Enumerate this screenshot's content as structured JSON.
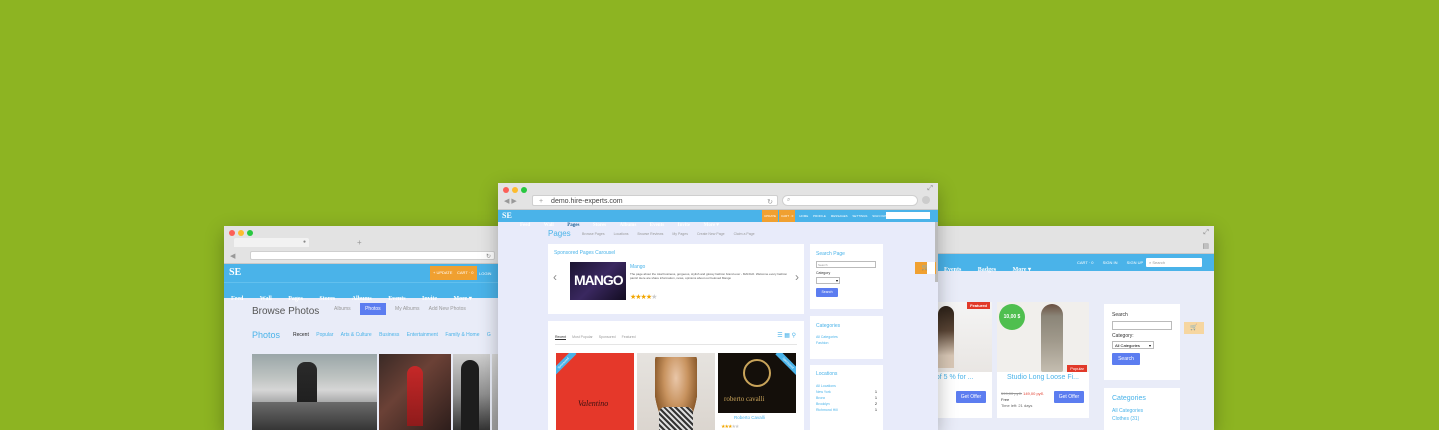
{
  "colors": {
    "background": "#8db422",
    "accent": "#4ab3e9",
    "button": "#5c7df0",
    "orange": "#f0a030",
    "red": "#e13a2a",
    "green": "#4fbf4f"
  },
  "left_window": {
    "logo": "SE",
    "top_pills": [
      "+ UPDATE",
      "CART · 0",
      "LOGIN"
    ],
    "nav": [
      "Feed",
      "Wall",
      "Pages",
      "Stores",
      "Albums",
      "Events",
      "Invite",
      "More ▾"
    ],
    "heading": "Browse Photos",
    "tabs": [
      "Albums",
      "Photos",
      "My Albums",
      "Add New Photos"
    ],
    "active_tab": "Photos",
    "section_title": "Photos",
    "filters": [
      "Recent",
      "Popular",
      "Arts & Culture",
      "Business",
      "Entertainment",
      "Family & Home",
      "G"
    ]
  },
  "center_window": {
    "url": "demo.hire-experts.com",
    "logo": "SE",
    "nav": [
      "Feed",
      "Wall",
      "Pages",
      "Stores",
      "Albums",
      "Events",
      "Invite",
      "More ▾"
    ],
    "top_right_items": [
      "UPDATE",
      "CART · 0",
      "HOME",
      "PROFILE",
      "MESSAGES",
      "SETTINGS",
      "SIGN OUT"
    ],
    "page_title": "Pages",
    "subnav": [
      "Browse Pages",
      "Locations",
      "Browse Reviews",
      "My Pages",
      "Create New Page",
      "Claim a Page"
    ],
    "carousel_title": "Sponsored Pages Carousel",
    "carousel_item": {
      "brand": "MANGO",
      "name": "Mango",
      "description": "The page about the total business, gorgeous, stylish and glossy fashion brand ever - MANGO. Welcome every fashion pants! Here are share information, news, opinions about our beloved Mango",
      "rating": 4
    },
    "search_panel": {
      "title": "Search Page",
      "input_placeholder": "Search",
      "category_label": "Category",
      "button": "Search"
    },
    "categories_panel": {
      "title": "Categories",
      "items": [
        "All Categories",
        "Fashion"
      ]
    },
    "locations_panel": {
      "title": "Locations",
      "items": [
        {
          "name": "All Locations",
          "count": ""
        },
        {
          "name": "New York",
          "count": "1"
        },
        {
          "name": "Bronx",
          "count": "1"
        },
        {
          "name": "Brooklyn",
          "count": "2"
        },
        {
          "name": "Richmond Hill",
          "count": "1"
        }
      ]
    },
    "list_tabs": [
      "Recent",
      "Most Popular",
      "Sponsored",
      "Featured"
    ],
    "list_active_tab": "Recent",
    "products": [
      {
        "brand": "Valentino",
        "ribbon": "Sponsored",
        "caption": ""
      },
      {
        "brand": "",
        "ribbon": "",
        "caption": ""
      },
      {
        "brand": "roberto cavalli",
        "ribbon": "Sponsored",
        "caption": "Roberto Cavalli",
        "rating": 3
      }
    ]
  },
  "right_window": {
    "nav": [
      "Events",
      "Badges",
      "More ▾"
    ],
    "top_links": [
      "CART · 0",
      "SIGN IN",
      "SIGN UP"
    ],
    "search_placeholder": "Search",
    "offers": [
      {
        "badge": "Featured",
        "title": "t of 5 % for ...",
        "button": "Get Offer"
      },
      {
        "price_bubble": "10,00 $",
        "badge": "Popular",
        "title": "Studio Long Loose Fi...",
        "old_price": "599,00 руб.",
        "new_price": "149,00 руб.",
        "free_label": "Free",
        "time_left": "Time left: 21 days",
        "button": "Get Offer"
      }
    ],
    "search_panel": {
      "title": "Search",
      "category_label": "Category:",
      "select_value": "All Categories",
      "button": "Search"
    },
    "categories_panel": {
      "title": "Categories",
      "items": [
        "All Categories",
        "Clothes (31)"
      ]
    }
  }
}
